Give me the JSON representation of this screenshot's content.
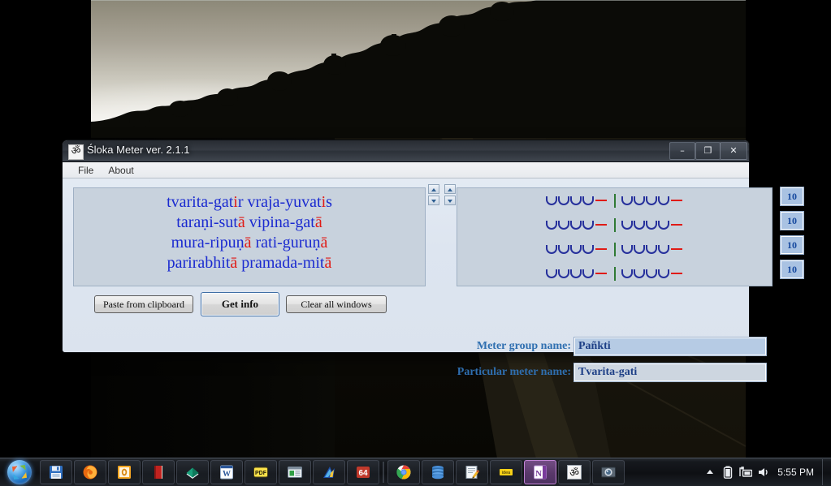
{
  "window": {
    "title": "Śloka Meter ver. 2.1.1",
    "icon": "om-symbol-icon",
    "icon_glyph": "ॐ",
    "controls": {
      "minimize": "–",
      "maximize": "❐",
      "close": "✕"
    }
  },
  "menubar": {
    "items": [
      {
        "label": "File",
        "name": "menu-file"
      },
      {
        "label": "About",
        "name": "menu-about"
      }
    ]
  },
  "verse": {
    "lines": [
      [
        {
          "t": "tvarita-gat",
          "long": false
        },
        {
          "t": "i",
          "long": true
        },
        {
          "t": "r vraja-yuvat",
          "long": false
        },
        {
          "t": "i",
          "long": true
        },
        {
          "t": "s",
          "long": false
        }
      ],
      [
        {
          "t": "taraṇi-sut",
          "long": false
        },
        {
          "t": "ā",
          "long": true
        },
        {
          "t": " vipina-gat",
          "long": false
        },
        {
          "t": "ā",
          "long": true
        }
      ],
      [
        {
          "t": "mura-ripuṇ",
          "long": false
        },
        {
          "t": "ā",
          "long": true
        },
        {
          "t": " rati-guruṇ",
          "long": false
        },
        {
          "t": "ā",
          "long": true
        }
      ],
      [
        {
          "t": "parirabhit",
          "long": false
        },
        {
          "t": "ā",
          "long": true
        },
        {
          "t": " pramada-mit",
          "long": false
        },
        {
          "t": "ā",
          "long": true
        }
      ]
    ],
    "plain_lines": [
      "tvarita-gatir vraja-yuvatis",
      "taraṇi-sutā vipina-gatā",
      "mura-ripuṇā rati-guruṇā",
      "parirabhitā pramada-mitā"
    ],
    "short_color": "#1a2ad0",
    "long_color": "#e01b16"
  },
  "scansion": {
    "rows": [
      {
        "ganas": [
          "UUUU-",
          "UUUU-"
        ],
        "count": "10"
      },
      {
        "ganas": [
          "UUUU-",
          "UUUU-"
        ],
        "count": "10"
      },
      {
        "ganas": [
          "UUUU-",
          "UUUU-"
        ],
        "count": "10"
      },
      {
        "ganas": [
          "UUUU-",
          "UUUU-"
        ],
        "count": "10"
      }
    ],
    "breve_color": "#26309c",
    "macron_color": "#e01b16",
    "caesura_color": "#2f7a34"
  },
  "buttons": {
    "paste": "Paste from clipboard",
    "get_info": "Get info",
    "clear": "Clear all windows"
  },
  "results": {
    "group_label": "Meter group name:",
    "group_value": "Pañkti",
    "particular_label": "Particular meter name:",
    "particular_value": "Tvarita-gati"
  },
  "taskbar": {
    "start": "start-orb",
    "items": [
      {
        "name": "taskbar-item-save",
        "icon": "floppy-disk-icon"
      },
      {
        "name": "taskbar-item-firefox",
        "icon": "firefox-icon"
      },
      {
        "name": "taskbar-item-office",
        "icon": "orange-square-icon"
      },
      {
        "name": "taskbar-item-book",
        "icon": "red-book-icon"
      },
      {
        "name": "taskbar-item-dictionary",
        "icon": "green-book-icon"
      },
      {
        "name": "taskbar-item-word",
        "icon": "word-icon"
      },
      {
        "name": "taskbar-item-pdf",
        "icon": "pdf-icon"
      },
      {
        "name": "taskbar-item-window",
        "icon": "window-icon"
      },
      {
        "name": "taskbar-item-editor",
        "icon": "blue-arrow-icon"
      },
      {
        "name": "taskbar-item-64",
        "icon": "sixty-four-icon",
        "label": "64"
      },
      {
        "name": "taskbar-item-chrome",
        "icon": "chrome-icon"
      },
      {
        "name": "taskbar-item-database",
        "icon": "database-icon"
      },
      {
        "name": "taskbar-item-notes",
        "icon": "notepad-pencil-icon"
      },
      {
        "name": "taskbar-item-idea",
        "icon": "idea-icon",
        "label": "idea"
      },
      {
        "name": "taskbar-item-onenote",
        "icon": "onenote-icon",
        "label": "N",
        "active": true
      },
      {
        "name": "taskbar-item-sloka-meter",
        "icon": "om-symbol-icon",
        "label": "ॐ"
      },
      {
        "name": "taskbar-item-photo",
        "icon": "photo-viewer-icon"
      }
    ],
    "tray": [
      {
        "name": "tray-show-hidden-icons",
        "icon": "chevron-up-icon"
      },
      {
        "name": "tray-battery",
        "icon": "battery-icon"
      },
      {
        "name": "tray-network",
        "icon": "network-icon"
      },
      {
        "name": "tray-volume",
        "icon": "speaker-icon"
      }
    ],
    "clock": "5:55 PM"
  }
}
